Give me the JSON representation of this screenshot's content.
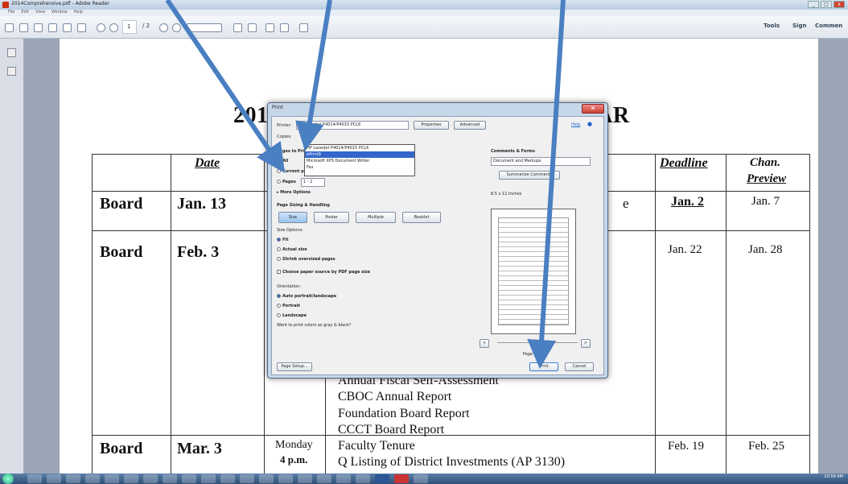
{
  "window": {
    "title": "2014Comprehensive.pdf - Adobe Reader",
    "menu": [
      "File",
      "Edit",
      "View",
      "Window",
      "Help"
    ]
  },
  "toolbar": {
    "page_current": "1",
    "page_total": "/ 2",
    "tools": "Tools",
    "sign": "Sign",
    "comment": "Commen"
  },
  "document": {
    "title": "2014 COMPREHENSIVE CALENDAR",
    "headers": {
      "date": "Date",
      "deadline": "Deadline",
      "preview_line1": "Chan.",
      "preview_line2": "Preview"
    },
    "rows": [
      {
        "type": "Board",
        "date": "Jan. 13",
        "deadline": "Jan. 2",
        "preview": "Jan. 7",
        "fragment": "e"
      },
      {
        "type": "Board",
        "date": "Feb. 3",
        "deadline": "Jan. 22",
        "preview": "Jan. 28"
      },
      {
        "type": "Board",
        "date": "Mar. 3",
        "day": "Monday",
        "time": "4 p.m.",
        "deadline": "Feb. 19",
        "preview": "Feb. 25"
      }
    ],
    "items_feb": [
      "Annual Fiscal Self-Assessment",
      "CBOC Annual Report",
      "Foundation Board Report",
      "CCCT Board Report"
    ],
    "items_mar": [
      "Faculty Tenure",
      "Q Listing of District Investments (AP 3130)"
    ]
  },
  "dialog": {
    "title": "Print",
    "printer_label": "Printer:",
    "printer_value": "HP LaserJet P4014/P4015 PCL6",
    "properties": "Properties",
    "advanced": "Advanced",
    "help": "Help",
    "printer_options": [
      "HP LaserJet P4014/P4015 PCL6",
      "ePrint9",
      "Microsoft XPS Document Writer",
      "Fax"
    ],
    "copies_label": "Copies:",
    "pages_heading": "Pages to Print",
    "all": "All",
    "current_page": "Current page",
    "pages": "Pages",
    "pages_value": "1 - 2",
    "more_options": "More Options",
    "sizing_heading": "Page Sizing & Handling",
    "size_btn": "Size",
    "poster_btn": "Poster",
    "multiple_btn": "Multiple",
    "booklet_btn": "Booklet",
    "size_options": "Size Options:",
    "fit": "Fit",
    "actual": "Actual size",
    "shrink": "Shrink oversized pages",
    "choose_source": "Choose paper source by PDF page size",
    "orientation": "Orientation:",
    "auto": "Auto portrait/landscape",
    "portrait": "Portrait",
    "landscape": "Landscape",
    "gray_q": "Want to print colors as gray & black?",
    "comments_heading": "Comments & Forms",
    "comments_value": "Document and Markups",
    "summarize": "Summarize Comments",
    "paper_size": "8.5 x 11 Inches",
    "page_indicator": "Page 1",
    "page_setup": "Page Setup...",
    "print": "Print",
    "cancel": "Cancel",
    "prev": "<",
    "next": ">"
  },
  "taskbar": {
    "clock": "10:59 AM"
  },
  "colors": {
    "arrow": "#4a7fc1",
    "selection": "#3366cc",
    "taskbar": "#2f4f76"
  }
}
